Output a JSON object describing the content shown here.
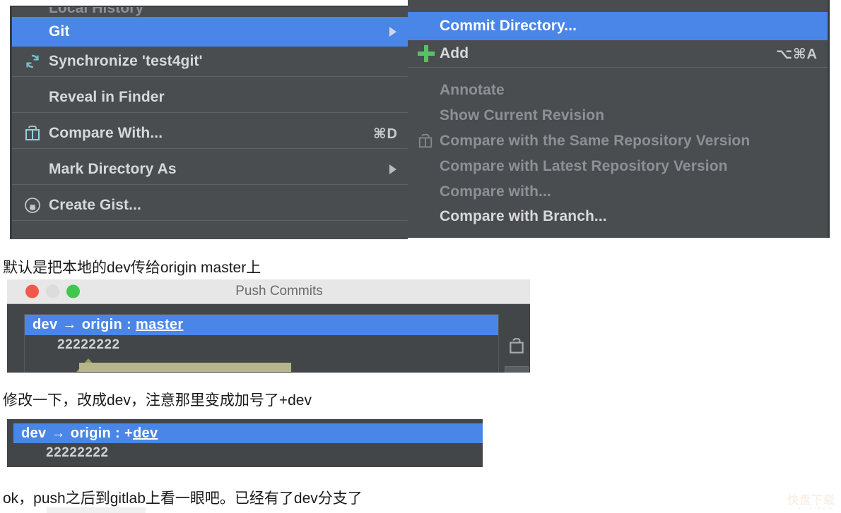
{
  "context_menu": {
    "left_panel": {
      "partial_top_item": "Local History",
      "items": [
        {
          "label": "Git",
          "icon": "",
          "accel": "",
          "submenu": true,
          "selected": true,
          "disabled": false
        },
        {
          "label": "Synchronize 'test4git'",
          "icon": "sync-icon",
          "accel": "",
          "submenu": false,
          "selected": false,
          "disabled": false
        },
        {
          "label": "Reveal in Finder",
          "icon": "",
          "accel": "",
          "submenu": false,
          "selected": false,
          "disabled": false
        },
        {
          "label": "Compare With...",
          "icon": "compare-icon",
          "accel": "⌘D",
          "submenu": false,
          "selected": false,
          "disabled": false
        },
        {
          "label": "Mark Directory As",
          "icon": "",
          "accel": "",
          "submenu": true,
          "selected": false,
          "disabled": false
        },
        {
          "label": "Create Gist...",
          "icon": "github-icon",
          "accel": "",
          "submenu": false,
          "selected": false,
          "disabled": false
        }
      ]
    },
    "right_panel": {
      "items": [
        {
          "label": "Commit Directory...",
          "icon": "",
          "accel": "",
          "selected": true,
          "disabled": false
        },
        {
          "label": "Add",
          "icon": "plus-icon",
          "accel": "⌥⌘A",
          "selected": false,
          "disabled": false
        },
        {
          "label": "Annotate",
          "icon": "",
          "accel": "",
          "selected": false,
          "disabled": true
        },
        {
          "label": "Show Current Revision",
          "icon": "",
          "accel": "",
          "selected": false,
          "disabled": true
        },
        {
          "label": "Compare with the Same Repository Version",
          "icon": "compare-icon",
          "accel": "",
          "selected": false,
          "disabled": true
        },
        {
          "label": "Compare with Latest Repository Version",
          "icon": "",
          "accel": "",
          "selected": false,
          "disabled": true
        },
        {
          "label": "Compare with...",
          "icon": "",
          "accel": "",
          "selected": false,
          "disabled": true
        },
        {
          "label": "Compare with Branch...",
          "icon": "",
          "accel": "",
          "selected": false,
          "disabled": false
        }
      ]
    }
  },
  "captions": {
    "one": "默认是把本地的dev传给origin master上",
    "two": "修改一下，改成dev，注意那里变成加号了+dev",
    "three": "ok，push之后到gitlab上看一眼吧。已经有了dev分支了"
  },
  "push_dialog": {
    "title": "Push Commits",
    "traffic_lights": {
      "close": "close-button",
      "minimize": "minimize-button",
      "maximize": "maximize-button"
    },
    "row": {
      "source": "dev",
      "arrow": "→",
      "remote": "origin",
      "separator": ":",
      "target": "master"
    },
    "commit_message": "22222222",
    "scroll_down_icon": "chevron-down-icon",
    "edit_icon": "edit-icon"
  },
  "push_dialog_2": {
    "row": {
      "source": "dev",
      "arrow": "→",
      "remote": "origin",
      "separator": ":",
      "target_prefix": "+",
      "target": "dev"
    },
    "commit_message": "22222222"
  },
  "watermark": {
    "text": "快盘下载",
    "subtext": "KUAIPAN"
  },
  "colors": {
    "menu_bg": "#4a4d50",
    "menu_selected": "#4a86e8",
    "menu_text": "#d7d8d9",
    "menu_disabled": "#8d9094",
    "accent_green": "#55c168",
    "accent_teal": "#6fc2cf",
    "dialog_bg": "#434648",
    "titlebar_bg": "#e7e7e7"
  }
}
